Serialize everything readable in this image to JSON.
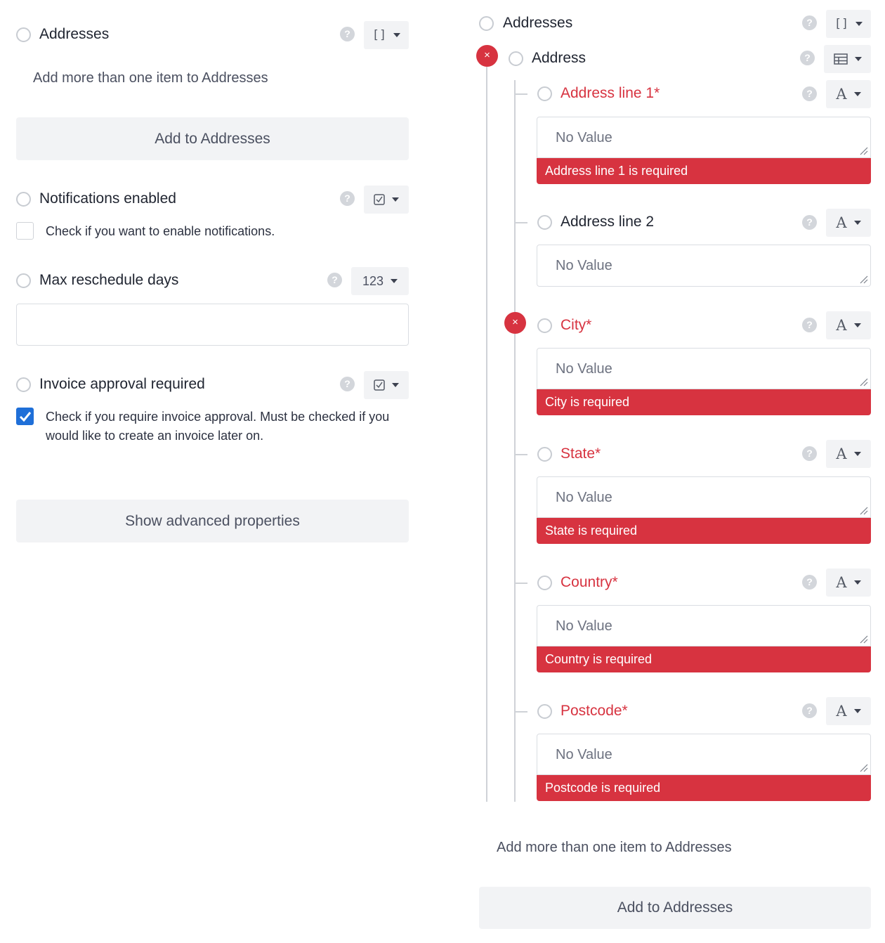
{
  "left": {
    "addresses": {
      "label": "Addresses",
      "help": "?",
      "type_glyph": "[]",
      "hint": "Add more than one item to Addresses",
      "add_button": "Add to Addresses"
    },
    "notifications": {
      "label": "Notifications enabled",
      "help": "?",
      "checkbox_text": "Check if you want to enable notifications.",
      "checked": false
    },
    "max_reschedule": {
      "label": "Max reschedule days",
      "help": "?",
      "type_label": "123",
      "value": ""
    },
    "invoice": {
      "label": "Invoice approval required",
      "help": "?",
      "checkbox_text_line1": "Check if you require invoice approval. Must be checked if you",
      "checkbox_text_line2": "would like to create an invoice later on.",
      "checked": true
    },
    "advanced_button": "Show advanced properties"
  },
  "right": {
    "addresses": {
      "label": "Addresses",
      "help": "?",
      "type_glyph": "[]"
    },
    "address": {
      "label": "Address",
      "help": "?",
      "error_icon": "×"
    },
    "fields": [
      {
        "label": "Address line 1*",
        "required": true,
        "placeholder": "No Value",
        "error": "Address line 1 is required",
        "type_glyph": "A",
        "help": "?"
      },
      {
        "label": "Address line 2",
        "required": false,
        "placeholder": "No Value",
        "error": "",
        "type_glyph": "A",
        "help": "?"
      },
      {
        "label": "City*",
        "required": true,
        "placeholder": "No Value",
        "error": "City is required",
        "type_glyph": "A",
        "help": "?",
        "error_icon": "×"
      },
      {
        "label": "State*",
        "required": true,
        "placeholder": "No Value",
        "error": "State is required",
        "type_glyph": "A",
        "help": "?"
      },
      {
        "label": "Country*",
        "required": true,
        "placeholder": "No Value",
        "error": "Country is required",
        "type_glyph": "A",
        "help": "?"
      },
      {
        "label": "Postcode*",
        "required": true,
        "placeholder": "No Value",
        "error": "Postcode is required",
        "type_glyph": "A",
        "help": "?"
      }
    ],
    "hint": "Add more than one item to Addresses",
    "add_button": "Add to Addresses"
  },
  "colors": {
    "error": "#d73340",
    "checkbox_checked": "#1f6fd8",
    "button_bg": "#f2f3f5"
  }
}
